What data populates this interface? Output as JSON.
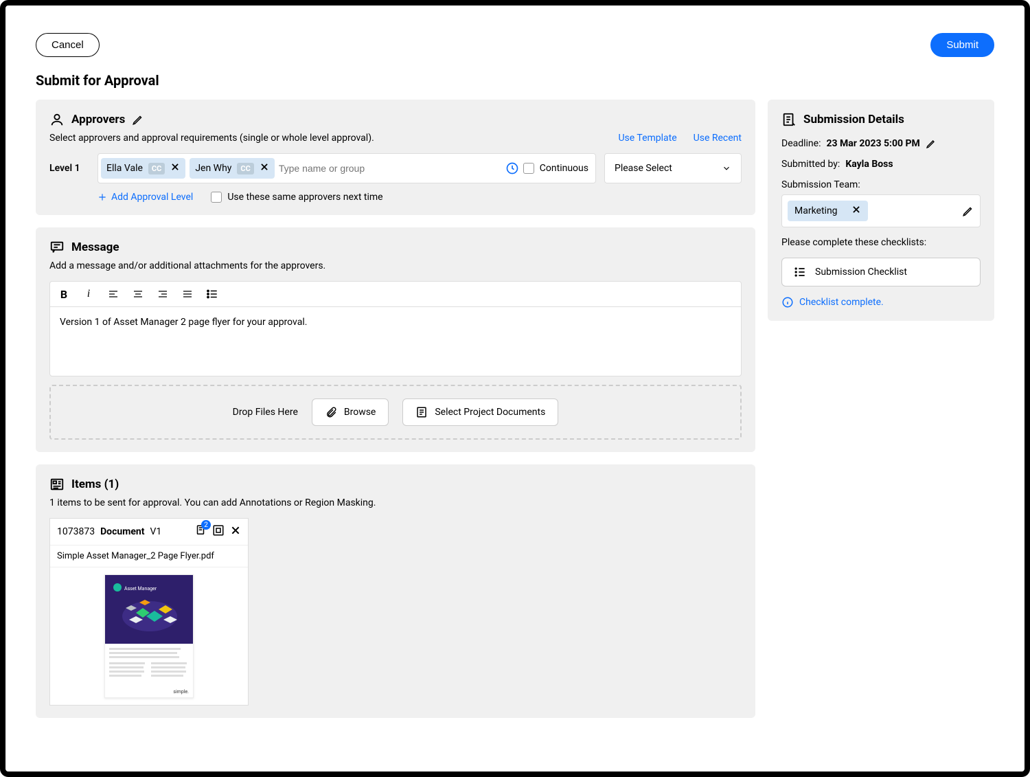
{
  "header": {
    "cancel": "Cancel",
    "submit": "Submit",
    "page_title": "Submit for Approval"
  },
  "approvers": {
    "title": "Approvers",
    "subtitle": "Select approvers and approval requirements (single or whole level approval).",
    "use_template": "Use Template",
    "use_recent": "Use Recent",
    "level_label": "Level 1",
    "chips": [
      {
        "name": "Ella Vale",
        "cc": "CC"
      },
      {
        "name": "Jen Why",
        "cc": "CC"
      }
    ],
    "input_placeholder": "Type name or group",
    "continuous_label": "Continuous",
    "select_placeholder": "Please Select",
    "add_level": "Add Approval Level",
    "same_next": "Use these same approvers next time"
  },
  "message": {
    "title": "Message",
    "subtitle": "Add a message and/or additional attachments for the approvers.",
    "body": "Version 1 of Asset Manager 2 page flyer for your approval.",
    "drop_label": "Drop Files Here",
    "browse": "Browse",
    "select_docs": "Select Project Documents"
  },
  "items": {
    "title": "Items (1)",
    "subtitle": "1 items to be sent for approval. You can add Annotations or Region Masking.",
    "card": {
      "id": "1073873",
      "type": "Document",
      "version": "V1",
      "badge_count": "2",
      "filename": "Simple Asset Manager_2 Page Flyer.pdf",
      "footer": "simple."
    }
  },
  "sidebar": {
    "title": "Submission Details",
    "deadline_label": "Deadline:",
    "deadline_value": "23 Mar 2023 5:00 PM",
    "submitted_by_label": "Submitted by:",
    "submitted_by_value": "Kayla Boss",
    "team_label": "Submission Team:",
    "team_chip": "Marketing",
    "checklist_prompt": "Please complete these checklists:",
    "checklist_btn": "Submission Checklist",
    "complete_msg": "Checklist complete."
  }
}
